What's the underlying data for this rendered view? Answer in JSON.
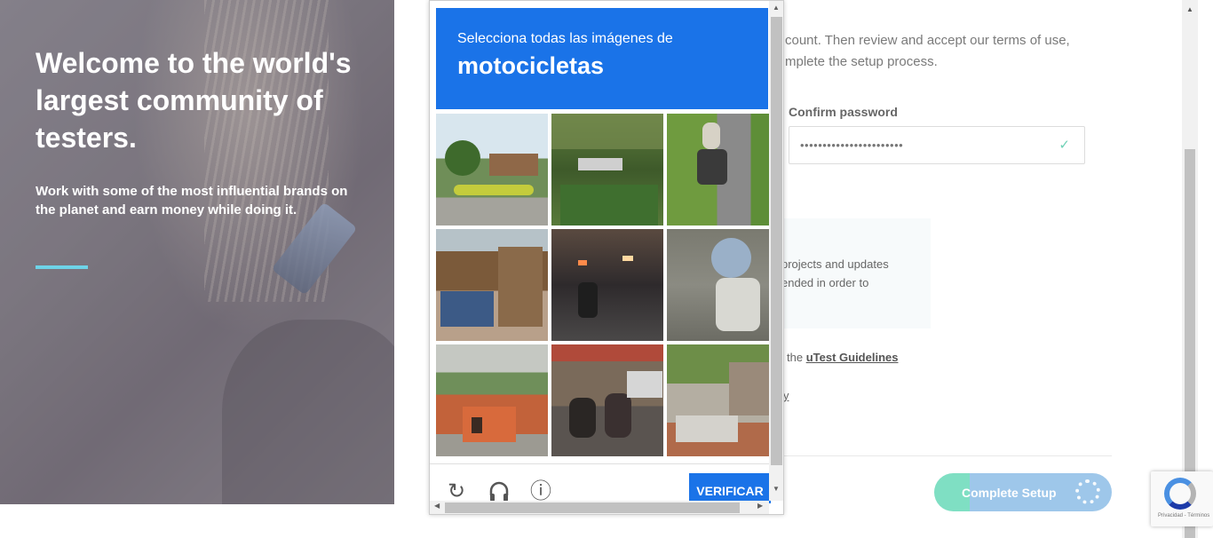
{
  "hero": {
    "title": "Welcome to the world's largest community of testers.",
    "subtitle": "Work with some of the most influential brands on the planet and earn money while doing it."
  },
  "form": {
    "intro_line1": "count. Then review and accept our terms of use,",
    "intro_line2": "mplete the setup process.",
    "confirm_password_label": "Confirm password",
    "confirm_password_value": "•••••••••••••••••••••••",
    "check_icon": "✓",
    "info_line1": "projects and updates",
    "info_line2": "ended in order to",
    "guidelines_prefix": "the",
    "guidelines_link": "uTest Guidelines",
    "fragment_y": "y",
    "complete_button": "Complete Setup"
  },
  "captcha": {
    "instruction": "Selecciona todas las imágenes de",
    "object": "motocicletas",
    "verify_button": "VERIFICAR",
    "icons": {
      "reload": "↻",
      "audio": "🎧",
      "info": "ⓘ"
    },
    "tiles": [
      {
        "name": "tile-roundabout"
      },
      {
        "name": "tile-trees-car"
      },
      {
        "name": "tile-scooter-road"
      },
      {
        "name": "tile-market-building"
      },
      {
        "name": "tile-night-traffic"
      },
      {
        "name": "tile-scooter-rider"
      },
      {
        "name": "tile-orange-building"
      },
      {
        "name": "tile-street-riders"
      },
      {
        "name": "tile-alley-house"
      }
    ]
  },
  "recaptcha_badge": {
    "text": "Privacidad - Términos"
  },
  "colors": {
    "captcha_blue": "#1a73e8",
    "hero_accent": "#6ed3e8",
    "button_green": "#7fdfc3",
    "button_blue": "#9ec7ea"
  }
}
